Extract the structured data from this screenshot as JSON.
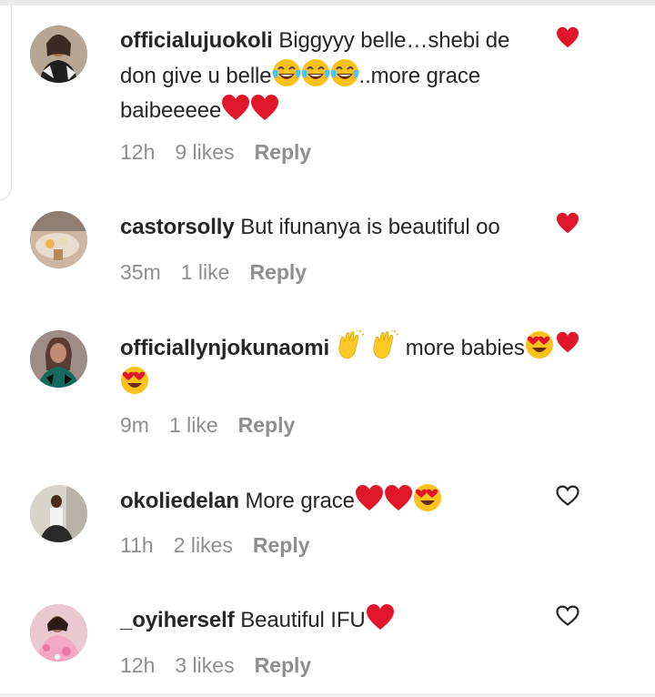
{
  "comments": [
    {
      "username": "officialujuokoli",
      "text_1": " Biggyyy belle…shebi de",
      "text_2": "don give u belle",
      "text_3": "..more grace",
      "text_4": "baibeeeee",
      "time": "12h",
      "likes": "9 likes",
      "reply": "Reply"
    },
    {
      "username": "castorsolly",
      "text": " But ifunanya is beautiful oo",
      "time": "35m",
      "likes": "1 like",
      "reply": "Reply"
    },
    {
      "username": "officiallynjokunaomi",
      "text": " more babies",
      "time": "9m",
      "likes": "1 like",
      "reply": "Reply"
    },
    {
      "username": "okoliedelan",
      "text": " More grace",
      "time": "11h",
      "likes": "2 likes",
      "reply": "Reply"
    },
    {
      "username": "_oyiherself",
      "text": " Beautiful IFU",
      "time": "12h",
      "likes": "3 likes",
      "reply": "Reply"
    }
  ],
  "colors": {
    "text": "#262626",
    "meta": "#8e8e8e",
    "heart_red": "#e0162b",
    "background": "#ffffff"
  },
  "icons": [
    "heart-like-icon",
    "red-heart-emoji",
    "tears-of-joy-emoji",
    "clapping-hands-emoji",
    "heart-eyes-emoji"
  ]
}
